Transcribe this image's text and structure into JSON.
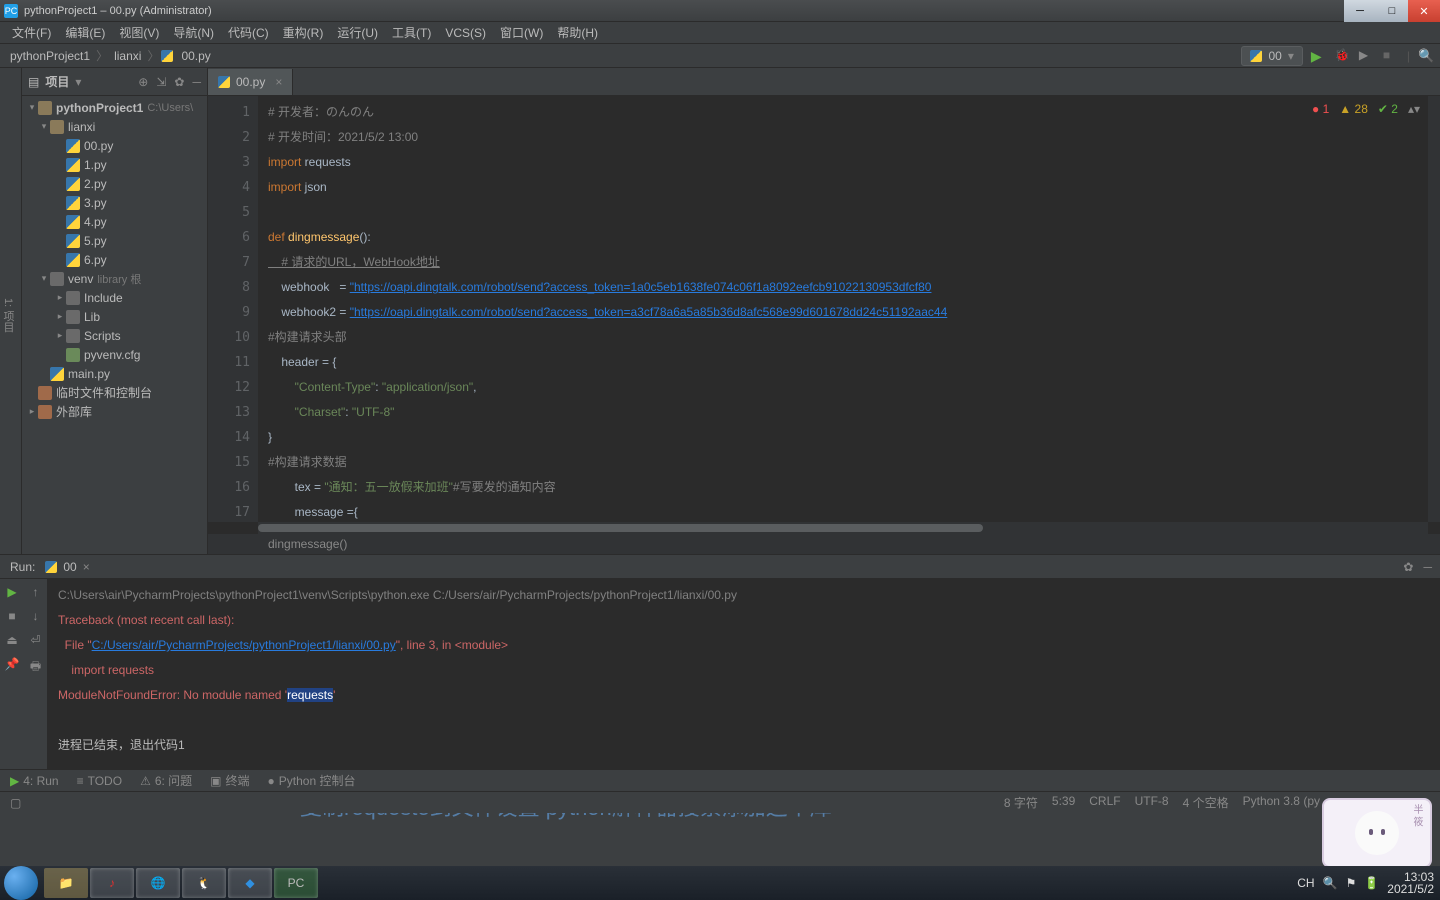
{
  "window": {
    "title": "pythonProject1 – 00.py (Administrator)"
  },
  "menu": [
    "文件(F)",
    "编辑(E)",
    "视图(V)",
    "导航(N)",
    "代码(C)",
    "重构(R)",
    "运行(U)",
    "工具(T)",
    "VCS(S)",
    "窗口(W)",
    "帮助(H)"
  ],
  "breadcrumbs": [
    "pythonProject1",
    "lianxi",
    "00.py"
  ],
  "runconfig": {
    "name": "00"
  },
  "project": {
    "header": "项目",
    "root": {
      "name": "pythonProject1",
      "hint": "C:\\Users\\"
    },
    "lianxi": "lianxi",
    "files": [
      "00.py",
      "1.py",
      "2.py",
      "3.py",
      "4.py",
      "5.py",
      "6.py"
    ],
    "venv": {
      "name": "venv",
      "hint": "library 根"
    },
    "venv_children": [
      "Include",
      "Lib",
      "Scripts",
      "pyvenv.cfg"
    ],
    "main": "main.py",
    "scratch": "临时文件和控制台",
    "ext": "外部库"
  },
  "tabs": [
    {
      "name": "00.py"
    }
  ],
  "inspections": {
    "errors": "1",
    "warnings": "28",
    "weak": "2"
  },
  "code": {
    "l1_a": "# 开发者：のんのん",
    "l2": "# 开发时间：2021/5/2 13:00",
    "l3_a": "import",
    "l3_b": " requests",
    "l4_a": "import",
    "l4_b": " json",
    "l6_a": "def ",
    "l6_b": "dingmessage",
    "l6_c": "():",
    "l7": "    # 请求的URL，WebHook地址",
    "l8_a": "    webhook   = ",
    "l8_b": "\"https://oapi.dingtalk.com/robot/send?access_token=1a0c5eb1638fe074c06f1a8092eefcb91022130953dfcf80",
    "l9_a": "    webhook2 = ",
    "l9_b": "\"https://oapi.dingtalk.com/robot/send?access_token=a3cf78a6a5a85b36d8afc568e99d601678dd24c51192aac44",
    "l10": "#构建请求头部",
    "l11": "    header = {",
    "l12_a": "        ",
    "l12_b": "\"Content-Type\"",
    "l12_c": ": ",
    "l12_d": "\"application/json\"",
    "l12_e": ",",
    "l13_a": "        ",
    "l13_b": "\"Charset\"",
    "l13_c": ": ",
    "l13_d": "\"UTF-8\"",
    "l14": "}",
    "l15": "#构建请求数据",
    "l16_a": "        tex = ",
    "l16_b": "\"通知：五一放假来加班\"",
    "l16_c": "#写要发的通知内容",
    "l17": "        message ={",
    "bc": "dingmessage()"
  },
  "run": {
    "label": "Run:",
    "cfg": "00",
    "l1": "C:\\Users\\air\\PycharmProjects\\pythonProject1\\venv\\Scripts\\python.exe C:/Users/air/PycharmProjects/pythonProject1/lianxi/00.py",
    "l2": "Traceback (most recent call last):",
    "l3_a": "  File \"",
    "l3_b": "C:/Users/air/PycharmProjects/pythonProject1/lianxi/00.py",
    "l3_c": "\", line 3, in <module>",
    "l4": "    import requests",
    "l5_a": "ModuleNotFoundError: No module named '",
    "l5_b": "requests",
    "l5_c": "'",
    "l7": "进程已结束，退出代码1"
  },
  "toolwins": {
    "run": "4: Run",
    "todo": "TODO",
    "problems": "6: 问题",
    "terminal": "终端",
    "pyconsole": "Python 控制台"
  },
  "overlay": "复制requeste到文件设置 python解释器搜索添加这个库",
  "status": {
    "chars": "8 字符",
    "pos": "5:39",
    "le": "CRLF",
    "enc": "UTF-8",
    "indent": "4 个空格",
    "interp": "Python 3.8 (py"
  },
  "tray": {
    "ime": "CH",
    "time": "13:03",
    "date": "2021/5/2"
  }
}
